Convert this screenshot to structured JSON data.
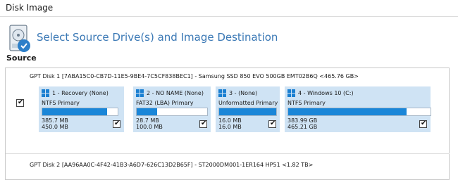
{
  "window": {
    "title": "Disk Image"
  },
  "header": {
    "text": "Select Source Drive(s) and Image Destination",
    "icon": "disk-image-icon"
  },
  "source": {
    "label": "Source"
  },
  "disks": [
    {
      "header": "GPT Disk 1 [7ABA15C0-CB7D-11E5-9BE4-7C5CF838BEC1] - Samsung SSD 850 EVO 500GB EMT02B6Q  <465.76 GB>",
      "checked": true,
      "partitions": [
        {
          "name": "1 - Recovery (None)",
          "type": "NTFS Primary",
          "used": "385.7 MB",
          "total": "450.0 MB",
          "fill_fraction": 0.86,
          "checked": true
        },
        {
          "name": "2 - NO NAME (None)",
          "type": "FAT32 (LBA) Primary",
          "used": "28.7 MB",
          "total": "100.0 MB",
          "fill_fraction": 0.29,
          "checked": true
        },
        {
          "name": "3 - (None)",
          "type": "Unformatted Primary",
          "used": "16.0 MB",
          "total": "16.0 MB",
          "fill_fraction": 1.0,
          "checked": true
        },
        {
          "name": "4 - Windows 10 (C:)",
          "type": "NTFS Primary",
          "used": "383.99 GB",
          "total": "465.21 GB",
          "fill_fraction": 0.83,
          "checked": true
        }
      ]
    },
    {
      "header": "GPT Disk 2 [AA96AA0C-4F42-41B3-A6D7-626C13D2B65F] - ST2000DM001-1ER164 HP51  <1.82 TB>"
    }
  ],
  "colors": {
    "accent": "#3a78b5",
    "partition_bg": "#cfe3f4",
    "bar_fill": "#1a86d8",
    "windows_logo": "#1a7fd1"
  },
  "check_glyph": "✔"
}
